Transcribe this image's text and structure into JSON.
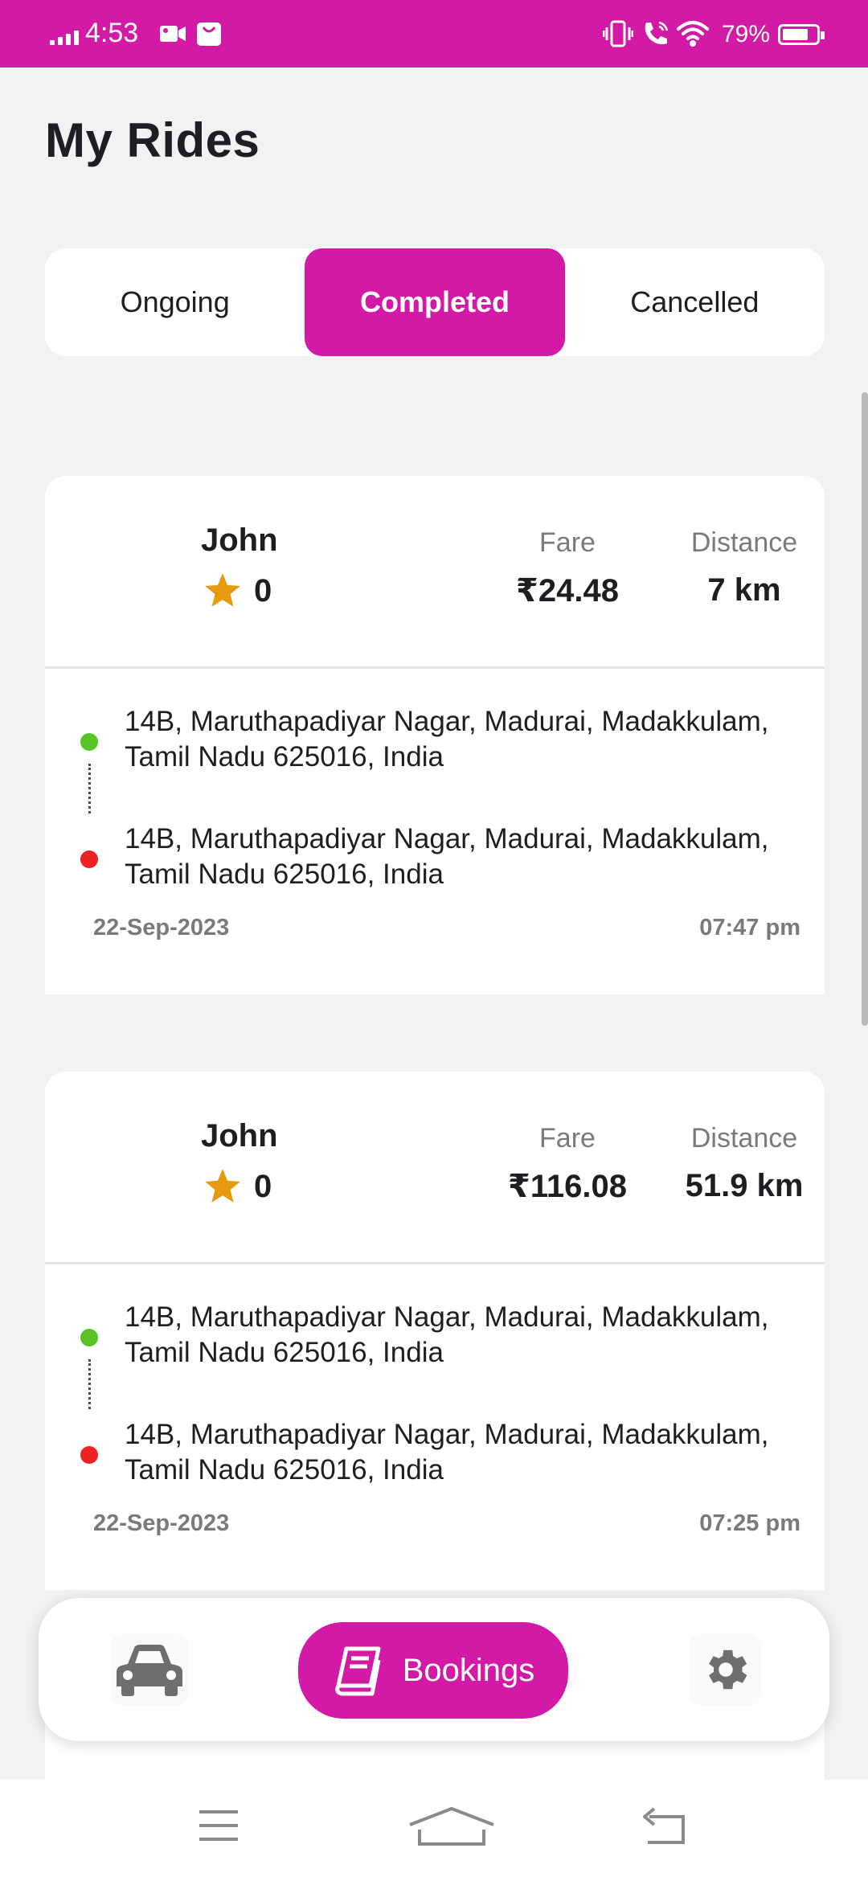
{
  "status_bar": {
    "time": "4:53",
    "battery": "79%",
    "battery_level": 0.79,
    "background": "#d21aa6"
  },
  "header": {
    "title": "My Rides"
  },
  "tabs": [
    {
      "label": "Ongoing",
      "active": false
    },
    {
      "label": "Completed",
      "active": true
    },
    {
      "label": "Cancelled",
      "active": false
    }
  ],
  "labels": {
    "fare": "Fare",
    "distance": "Distance"
  },
  "rides": [
    {
      "driver": "John",
      "rating": "0",
      "fare": "₹24.48",
      "distance": "7 km",
      "pickup": "14B, Maruthapadiyar Nagar, Madurai, Madakkulam, Tamil Nadu 625016, India",
      "drop": "14B, Maruthapadiyar Nagar, Madurai, Madakkulam, Tamil Nadu 625016, India",
      "date": "22-Sep-2023",
      "time": "07:47 pm"
    },
    {
      "driver": "John",
      "rating": "0",
      "fare": "₹116.08",
      "distance": "51.9 km",
      "pickup": "14B, Maruthapadiyar Nagar, Madurai, Madakkulam, Tamil Nadu 625016, India",
      "drop": "14B, Maruthapadiyar Nagar, Madurai, Madakkulam, Tamil Nadu 625016, India",
      "date": "22-Sep-2023",
      "time": "07:25 pm"
    }
  ],
  "bottom_nav": {
    "items": [
      {
        "icon": "car-icon",
        "label": ""
      },
      {
        "icon": "book-icon",
        "label": "Bookings",
        "active": true
      },
      {
        "icon": "gear-icon",
        "label": ""
      }
    ]
  },
  "colors": {
    "accent": "#d21aa6",
    "pickup_dot": "#58c226",
    "drop_dot": "#ee2222",
    "star": "#e59b0c"
  }
}
